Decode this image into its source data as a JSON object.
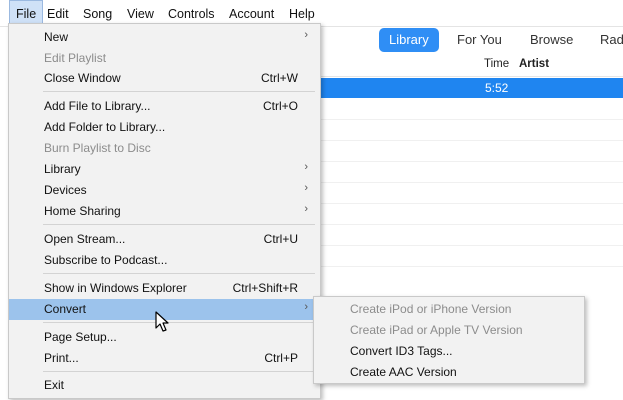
{
  "menubar": {
    "items": [
      "File",
      "Edit",
      "Song",
      "View",
      "Controls",
      "Account",
      "Help"
    ]
  },
  "nav_tabs": [
    "Library",
    "For You",
    "Browse",
    "Rad"
  ],
  "list": {
    "columns": [
      "Time",
      "Artist"
    ],
    "selected_row": {
      "time": "5:52"
    }
  },
  "file_menu": {
    "items": [
      {
        "label": "New",
        "submenu": true
      },
      {
        "label": "Edit Playlist",
        "disabled": true
      },
      {
        "label": "Close Window",
        "shortcut": "Ctrl+W"
      },
      {
        "label": "Add File to Library...",
        "shortcut": "Ctrl+O"
      },
      {
        "label": "Add Folder to Library..."
      },
      {
        "label": "Burn Playlist to Disc",
        "disabled": true
      },
      {
        "label": "Library",
        "submenu": true
      },
      {
        "label": "Devices",
        "submenu": true
      },
      {
        "label": "Home Sharing",
        "submenu": true
      },
      {
        "label": "Open Stream...",
        "shortcut": "Ctrl+U"
      },
      {
        "label": "Subscribe to Podcast..."
      },
      {
        "label": "Show in Windows Explorer",
        "shortcut": "Ctrl+Shift+R"
      },
      {
        "label": "Convert",
        "submenu": true,
        "highlighted": true
      },
      {
        "label": "Page Setup..."
      },
      {
        "label": "Print...",
        "shortcut": "Ctrl+P"
      },
      {
        "label": "Exit"
      }
    ]
  },
  "convert_submenu": {
    "items": [
      {
        "label": "Create iPod or iPhone Version",
        "disabled": true
      },
      {
        "label": "Create iPad or Apple TV Version",
        "disabled": true
      },
      {
        "label": "Convert ID3 Tags..."
      },
      {
        "label": "Create AAC Version"
      }
    ]
  },
  "colors": {
    "accent": "#2f8ef5",
    "menu_highlight": "#9cc3ec",
    "selected_row": "#1f85f0",
    "menu_bg": "#f2f2f2"
  }
}
